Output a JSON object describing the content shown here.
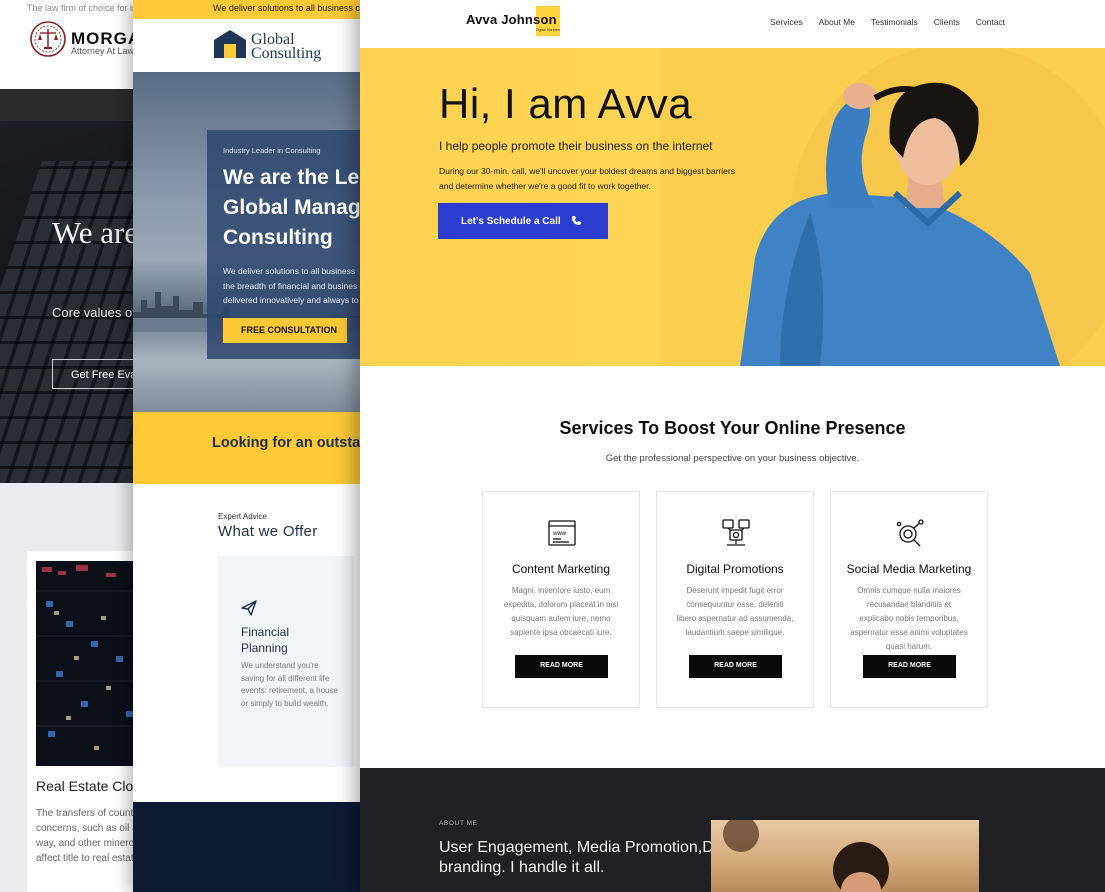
{
  "law_site": {
    "tagline": "The law firm of choice for in",
    "brand": "MORGAN",
    "brand_sub": "Attorney At Law",
    "hero_title": "We are here to service",
    "hero_text": "Core values of everything that",
    "cta_label": "Get Free Eval",
    "card_title": "Real Estate Clo",
    "card_body": "The transfers of count concerns, such as oil a way, and other minero affect title to real estat"
  },
  "consulting_site": {
    "topbar": "We deliver solutions to all business challe",
    "brand_line1": "Global",
    "brand_line2": "Consulting",
    "hero_label": "Industry Leader in Consulting",
    "hero_title": "We are the Le Global Manag Consulting",
    "hero_text": "We deliver solutions to all business the breadth of financial and busines delivered innovatively and always to",
    "hero_button": "FREE CONSULTATION",
    "banner_text": "Looking for an outsta",
    "section_kicker": "Expert Advice",
    "section_title": "What we Offer",
    "service_title": "Financial Planning",
    "service_text": "We understand you're saving for all different life events: retirement, a house or simply to build wealth."
  },
  "avva_site": {
    "logo": "Avva Johnson",
    "logo_sub": "Digital Marketer",
    "nav": [
      "Services",
      "About Me",
      "Testimonials",
      "Clients",
      "Contact"
    ],
    "hero_title": "Hi, I am Avva",
    "hero_subtitle": "I help people promote their business on the internet",
    "hero_description": "During our 30-min. call, we'll uncover your boldest dreams and biggest barriers and determine whether we're a good fit to work together.",
    "cta_label": "Let's Schedule a Call",
    "services_heading": "Services To Boost Your Online Presence",
    "services_subheading": "Get the professional perspective on your business objective.",
    "services": [
      {
        "icon": "web-browser-icon",
        "title": "Content Marketing",
        "text": "Magni, inventore iusto, eum expedita, dolorum placeat in nisi quisquam autem iure, nemo sapiente ipsa obcaecati iure.",
        "button": "READ MORE"
      },
      {
        "icon": "network-promotion-icon",
        "title": "Digital Promotions",
        "text": "Deserunt impedit fugit error consequuntur esse, deleniti libero aspernatur ad assumenda, laudantium saepe similique.",
        "button": "READ MORE"
      },
      {
        "icon": "magnifier-network-icon",
        "title": "Social Media Marketing",
        "text": "Omnis cumque nulla maiores recusandae blanditiis et explicabo nobis temporibus, aspernatur esse animi voluptates quasi harum.",
        "button": "READ MORE"
      }
    ],
    "about_kicker": "ABOUT ME",
    "about_title": "User Engagement, Media Promotion,Digital branding. I handle it all."
  },
  "colors": {
    "yellow": "#fdd250",
    "cta_blue": "#2b3ed0",
    "navy": "#0d1a34",
    "dark": "#202124"
  }
}
